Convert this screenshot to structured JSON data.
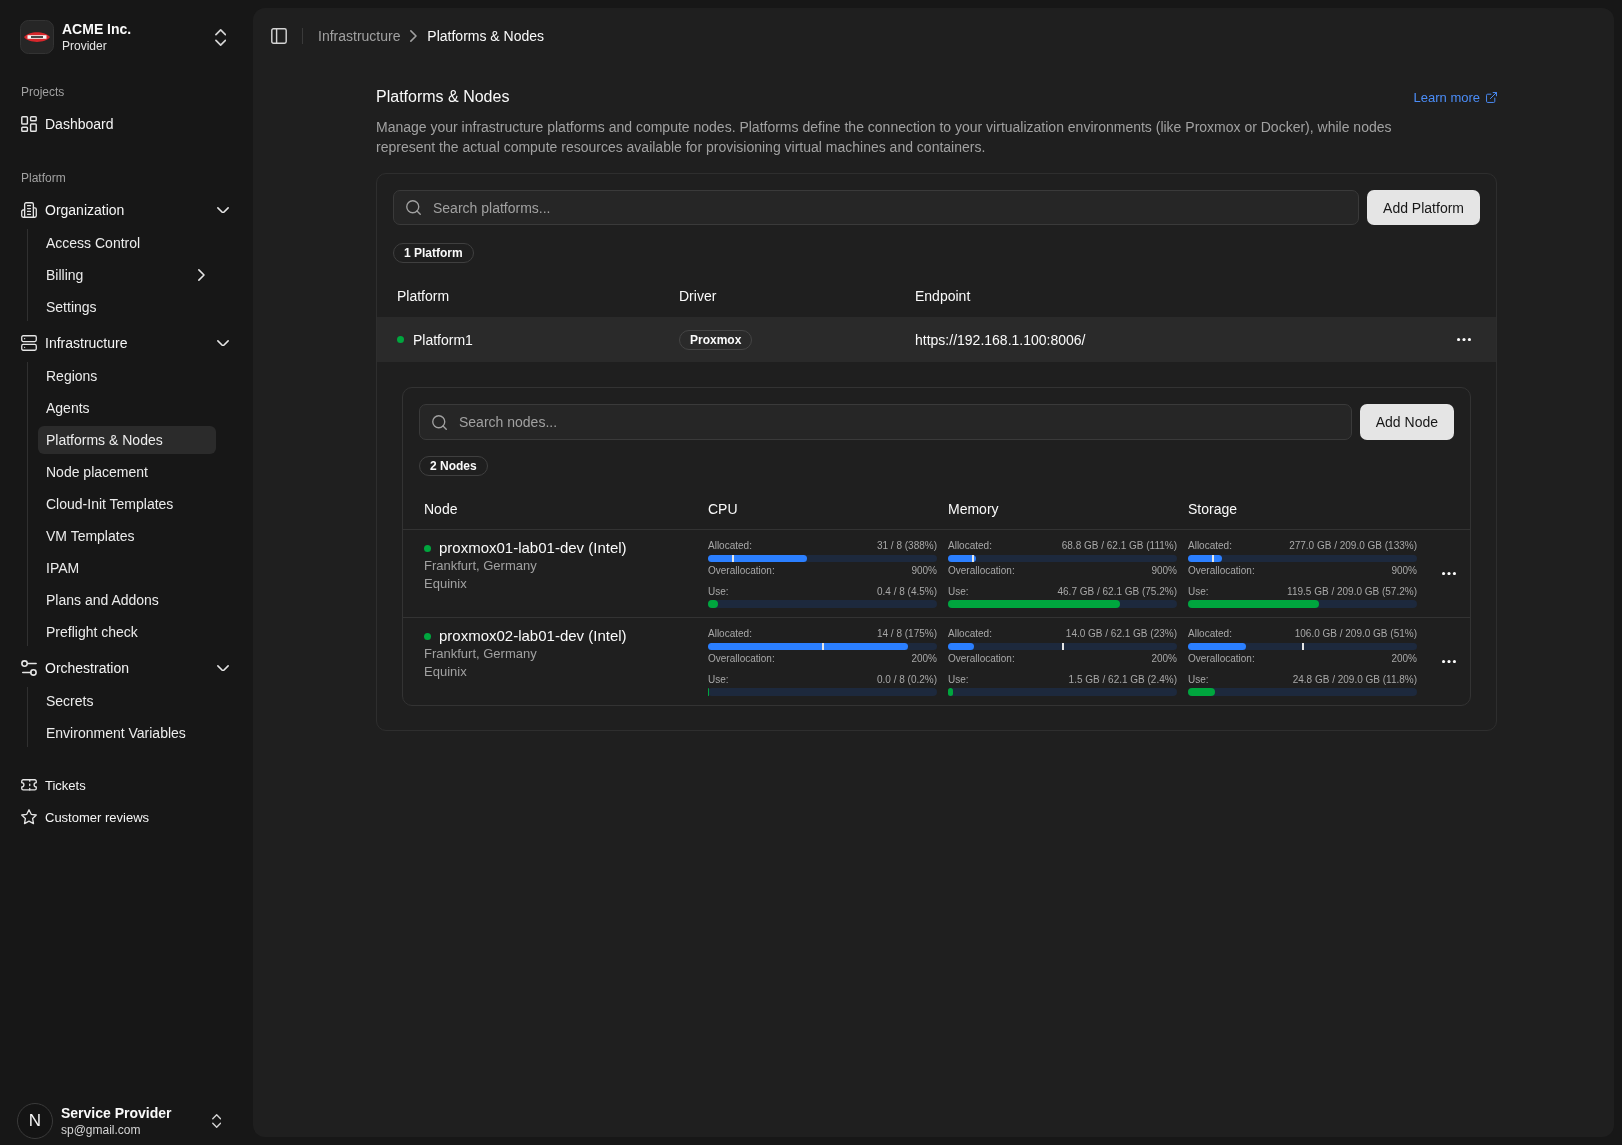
{
  "sidebar": {
    "org": {
      "name": "ACME Inc.",
      "role": "Provider"
    },
    "groups": [
      {
        "kind": "main",
        "label": "Projects",
        "items": [
          {
            "label": "Dashboard",
            "selected": false
          }
        ]
      },
      {
        "kind": "main",
        "label": "Platform",
        "items": [
          {
            "label": "Organization",
            "selected": false,
            "expanded": true,
            "children": [
              {
                "label": "Access Control",
                "selected": false
              },
              {
                "label": "Billing",
                "selected": false,
                "expanded": false
              },
              {
                "label": "Settings",
                "selected": false
              }
            ]
          },
          {
            "label": "Infrastructure",
            "selected": false,
            "expanded": true,
            "children": [
              {
                "label": "Regions",
                "selected": false
              },
              {
                "label": "Agents",
                "selected": false
              },
              {
                "label": "Platforms & Nodes",
                "selected": true
              },
              {
                "label": "Node placement",
                "selected": false
              },
              {
                "label": "Cloud-Init Templates",
                "selected": false
              },
              {
                "label": "VM Templates",
                "selected": false
              },
              {
                "label": "IPAM",
                "selected": false
              },
              {
                "label": "Plans and Addons",
                "selected": false
              },
              {
                "label": "Preflight check",
                "selected": false
              }
            ]
          },
          {
            "label": "Orchestration",
            "selected": false,
            "expanded": true,
            "children": [
              {
                "label": "Secrets",
                "selected": false
              },
              {
                "label": "Environment Variables",
                "selected": false
              }
            ]
          }
        ]
      },
      {
        "kind": "secondary",
        "items": [
          {
            "label": "Tickets",
            "selected": false
          },
          {
            "label": "Customer reviews",
            "selected": false
          }
        ]
      }
    ],
    "user": {
      "initial": "N",
      "name": "Service Provider",
      "email": "sp@gmail.com"
    }
  },
  "breadcrumb": [
    {
      "label": "Infrastructure",
      "current": false
    },
    {
      "label": "Platforms & Nodes",
      "current": true
    }
  ],
  "page": {
    "title": "Platforms & Nodes",
    "learn_more": "Learn more",
    "description": "Manage your infrastructure platforms and compute nodes. Platforms define the connection to your virtualization environments (like Proxmox or Docker), while nodes represent the actual compute resources available for provisioning virtual machines and containers."
  },
  "platforms": {
    "search": {
      "placeholder": "Search platforms..."
    },
    "add_button": "Add Platform",
    "count_badge": "1 Platform",
    "columns": [
      "Platform",
      "Driver",
      "Endpoint"
    ],
    "rows": [
      {
        "name": "Platform1",
        "online": true,
        "driver": "Proxmox",
        "endpoint": "https://192.168.1.100:8006/",
        "expanded": true,
        "nodes": {
          "search": {
            "placeholder": "Search nodes..."
          },
          "add_button": "Add Node",
          "count_badge": "2 Nodes",
          "columns": [
            "Node",
            "CPU",
            "Memory",
            "Storage"
          ],
          "rows": [
            {
              "name": "proxmox01-lab01-dev (Intel)",
              "online": true,
              "location": "Frankfurt, Germany",
              "provider": "Equinix",
              "metrics": [
                {
                  "allocated": {
                    "label": "Allocated:",
                    "reading": "31 / 8 (388%)",
                    "level": 0.431,
                    "limit": {
                      "level": 0.111
                    }
                  },
                  "overallocation": {
                    "label": "Overallocation:",
                    "reading": "900%"
                  },
                  "use": {
                    "label": "Use:",
                    "reading": "0.4 / 8 (4.5%)",
                    "level": 0.045
                  }
                },
                {
                  "allocated": {
                    "label": "Allocated:",
                    "reading": "68.8 GB / 62.1 GB (111%)",
                    "level": 0.123,
                    "limit": {
                      "level": 0.111
                    }
                  },
                  "overallocation": {
                    "label": "Overallocation:",
                    "reading": "900%"
                  },
                  "use": {
                    "label": "Use:",
                    "reading": "46.7 GB / 62.1 GB (75.2%)",
                    "level": 0.752
                  }
                },
                {
                  "allocated": {
                    "label": "Allocated:",
                    "reading": "277.0 GB / 209.0 GB (133%)",
                    "level": 0.148,
                    "limit": {
                      "level": 0.111
                    }
                  },
                  "overallocation": {
                    "label": "Overallocation:",
                    "reading": "900%"
                  },
                  "use": {
                    "label": "Use:",
                    "reading": "119.5 GB / 209.0 GB (57.2%)",
                    "level": 0.572
                  }
                }
              ]
            },
            {
              "name": "proxmox02-lab01-dev (Intel)",
              "online": true,
              "location": "Frankfurt, Germany",
              "provider": "Equinix",
              "metrics": [
                {
                  "allocated": {
                    "label": "Allocated:",
                    "reading": "14 / 8 (175%)",
                    "level": 0.875,
                    "limit": {
                      "level": 0.5
                    }
                  },
                  "overallocation": {
                    "label": "Overallocation:",
                    "reading": "200%"
                  },
                  "use": {
                    "label": "Use:",
                    "reading": "0.0 / 8 (0.2%)",
                    "level": 0.002
                  }
                },
                {
                  "allocated": {
                    "label": "Allocated:",
                    "reading": "14.0 GB / 62.1 GB (23%)",
                    "level": 0.115,
                    "limit": {
                      "level": 0.5
                    }
                  },
                  "overallocation": {
                    "label": "Overallocation:",
                    "reading": "200%"
                  },
                  "use": {
                    "label": "Use:",
                    "reading": "1.5 GB / 62.1 GB (2.4%)",
                    "level": 0.024
                  }
                },
                {
                  "allocated": {
                    "label": "Allocated:",
                    "reading": "106.0 GB / 209.0 GB (51%)",
                    "level": 0.255,
                    "limit": {
                      "level": 0.5
                    }
                  },
                  "overallocation": {
                    "label": "Overallocation:",
                    "reading": "200%"
                  },
                  "use": {
                    "label": "Use:",
                    "reading": "24.8 GB / 209.0 GB (11.8%)",
                    "level": 0.118
                  }
                }
              ]
            }
          ]
        }
      }
    ]
  }
}
